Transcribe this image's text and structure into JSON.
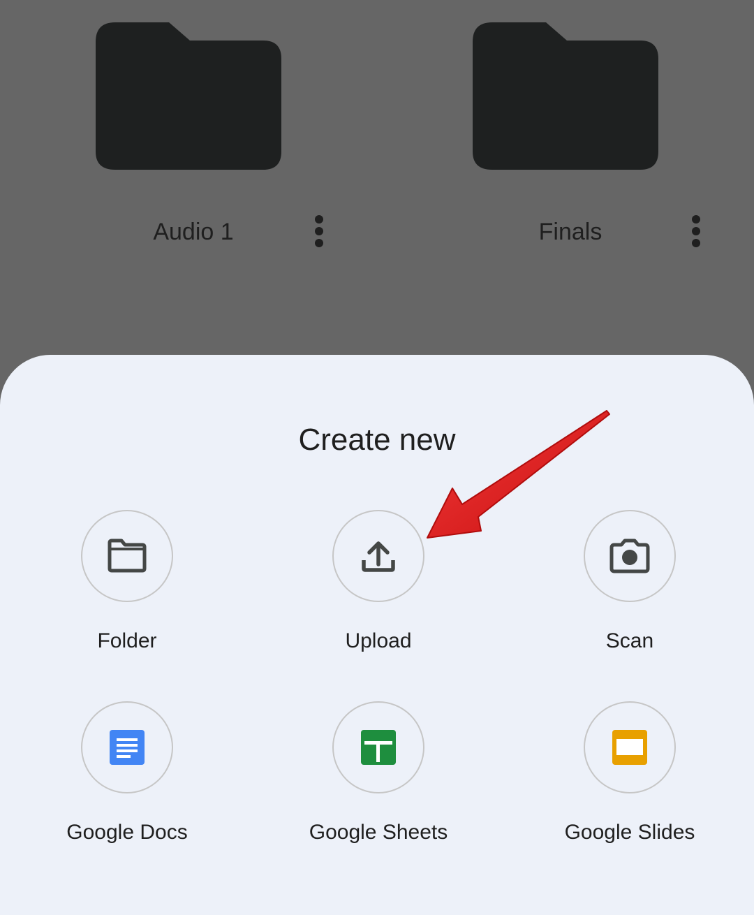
{
  "folders": [
    {
      "name": "Audio 1",
      "icon": "folder-icon",
      "menu_icon": "more-vert-icon"
    },
    {
      "name": "Finals",
      "icon": "folder-icon",
      "menu_icon": "more-vert-icon"
    }
  ],
  "sheet": {
    "title": "Create new",
    "options": [
      {
        "label": "Folder",
        "icon": "folder-outline-icon"
      },
      {
        "label": "Upload",
        "icon": "upload-icon"
      },
      {
        "label": "Scan",
        "icon": "camera-icon"
      },
      {
        "label": "Google Docs",
        "icon": "google-docs-icon",
        "color": "#4285f4"
      },
      {
        "label": "Google Sheets",
        "icon": "google-sheets-icon",
        "color": "#1e8e3e"
      },
      {
        "label": "Google Slides",
        "icon": "google-slides-icon",
        "color": "#e8a000"
      }
    ]
  },
  "colors": {
    "scrim": "#666666",
    "folder_fill": "#1e2020",
    "sheet_background": "#edf1f9",
    "icon_gray": "#444746",
    "annotation_arrow": "#e01a1a"
  },
  "annotation": {
    "type": "arrow",
    "points_to": "Upload"
  }
}
